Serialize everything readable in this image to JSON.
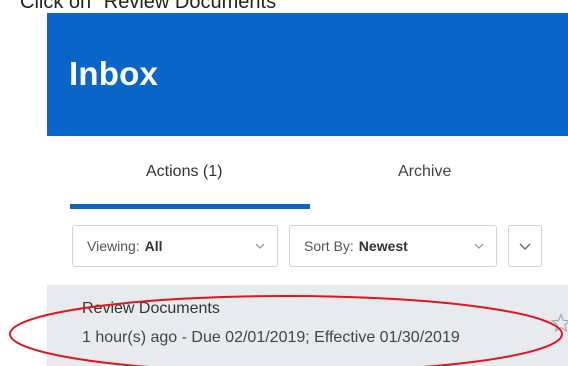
{
  "instruction": "Click on \"Review Documents\"",
  "header": {
    "title": "Inbox",
    "bg_color": "#0a65c8"
  },
  "tabs": [
    {
      "label": "Actions (1)",
      "active": true
    },
    {
      "label": "Archive",
      "active": false
    }
  ],
  "filters": {
    "viewing": {
      "label": "Viewing:",
      "value": "All"
    },
    "sort": {
      "label": "Sort By:",
      "value": "Newest"
    }
  },
  "inbox_item": {
    "title": "Review Documents",
    "subtitle": "1 hour(s) ago - Due 02/01/2019; Effective 01/30/2019"
  },
  "icons": {
    "chevron": "chevron-down-icon",
    "star": "star-outline-icon"
  },
  "annotation_color": "#e0141e"
}
